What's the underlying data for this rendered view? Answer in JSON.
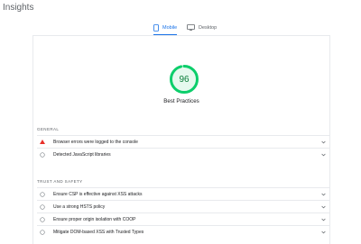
{
  "page": {
    "title": "Insights"
  },
  "tabs": [
    {
      "label": "Mobile",
      "icon": "phone-icon",
      "active": true
    },
    {
      "label": "Desktop",
      "icon": "monitor-icon",
      "active": false
    }
  ],
  "score": {
    "value": "96",
    "label": "Best Practices",
    "fraction": 0.96,
    "color": "#0cce6b",
    "text_color": "#0c7d3a"
  },
  "sections": [
    {
      "label": "GENERAL",
      "items": [
        {
          "text": "Browser errors were logged to the console",
          "status": "fail",
          "icon": "warning-triangle-icon"
        },
        {
          "text": "Detected JavaScript libraries",
          "status": "info",
          "icon": "circle-icon"
        }
      ]
    },
    {
      "label": "TRUST AND SAFETY",
      "items": [
        {
          "text": "Ensure CSP is effective against XSS attacks",
          "status": "info",
          "icon": "circle-icon"
        },
        {
          "text": "Use a strong HSTS policy",
          "status": "info",
          "icon": "circle-icon"
        },
        {
          "text": "Ensure proper origin isolation with COOP",
          "status": "info",
          "icon": "circle-icon"
        },
        {
          "text": "Mitigate DOM-based XSS with Trusted Types",
          "status": "info",
          "icon": "circle-icon"
        }
      ]
    }
  ],
  "colors": {
    "accent": "#1a73e8",
    "fail": "#e8302a",
    "pass": "#0cce6b"
  }
}
